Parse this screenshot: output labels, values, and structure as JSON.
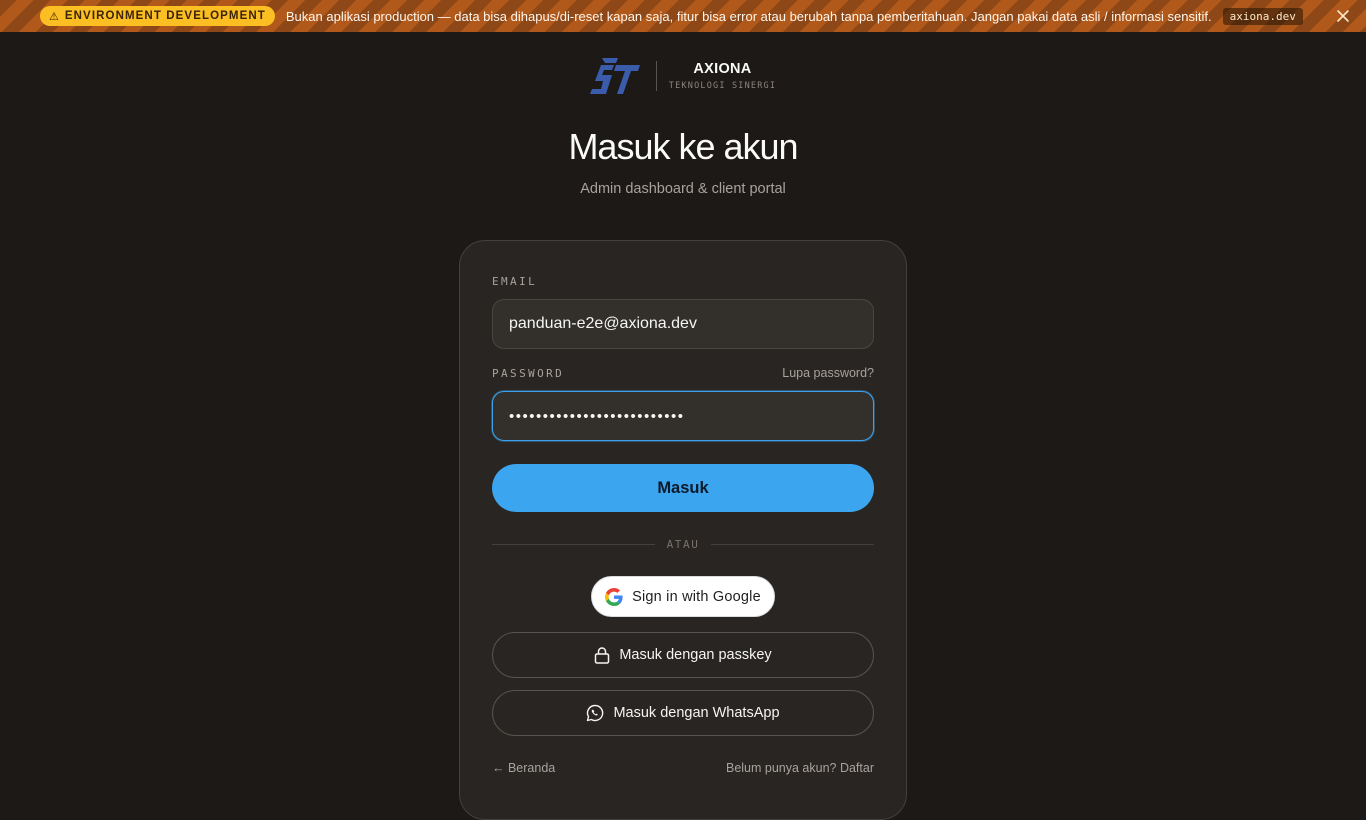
{
  "banner": {
    "badge_label": "ENVIRONMENT DEVELOPMENT",
    "badge_icon": "warning-triangle-icon",
    "message": "Bukan aplikasi production — data bisa dihapus/di-reset kapan saja, fitur bisa error atau berubah tanpa pemberitahuan. Jangan pakai data asli / informasi sensitif.",
    "domain": "axiona.dev",
    "close_icon": "close-icon",
    "colors": {
      "stripe_dark": "#8e4716",
      "stripe_light": "#b1591a",
      "badge": "#fbbf24"
    }
  },
  "brand": {
    "name": "AXIONA",
    "tagline": "TEKNOLOGI SINERGI",
    "logo_color": "#3b5bab"
  },
  "heading": {
    "title": "Masuk ke akun",
    "subtitle": "Admin dashboard & client portal"
  },
  "form": {
    "email_label": "EMAIL",
    "email_value": "panduan-e2e@axiona.dev",
    "password_label": "PASSWORD",
    "password_value": "••••••••••••••••••••••••••",
    "forgot_password": "Lupa password?",
    "submit_label": "Masuk",
    "divider_label": "ATAU"
  },
  "auth_options": {
    "google_label": "Sign in with Google",
    "passkey_label": "Masuk dengan passkey",
    "whatsapp_label": "Masuk dengan WhatsApp"
  },
  "footer": {
    "home_link": "← Beranda",
    "register_link": "Belum punya akun? Daftar"
  },
  "colors": {
    "background": "#1c1917",
    "card": "#282522",
    "accent": "#3ba5f0",
    "focus_ring": "#3ba2ee"
  }
}
